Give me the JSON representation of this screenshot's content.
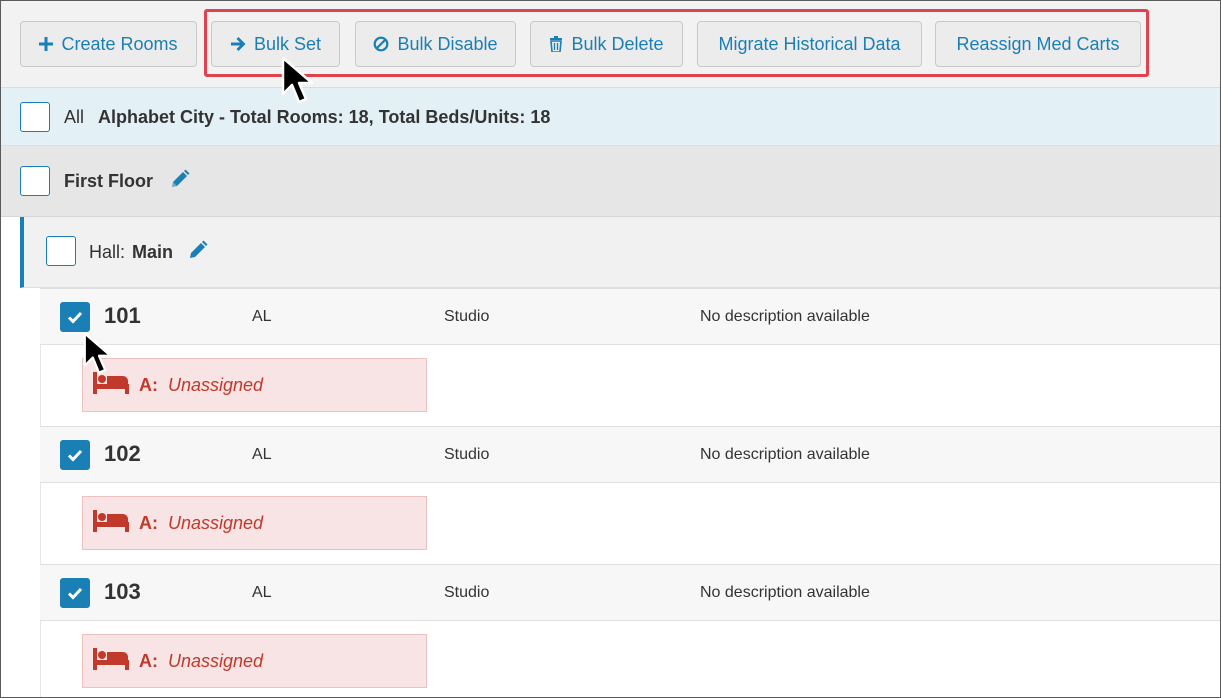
{
  "toolbar": {
    "create_rooms": "Create Rooms",
    "bulk_set": "Bulk Set",
    "bulk_disable": "Bulk Disable",
    "bulk_delete": "Bulk Delete",
    "migrate": "Migrate Historical Data",
    "reassign": "Reassign Med Carts"
  },
  "summary": {
    "all_label": "All",
    "text": "Alphabet City - Total Rooms: 18, Total Beds/Units: 18"
  },
  "floor": {
    "name": "First Floor"
  },
  "hall": {
    "prefix": "Hall:",
    "name": "Main"
  },
  "rooms": [
    {
      "number": "101",
      "type": "AL",
      "layout": "Studio",
      "description": "No description available",
      "bed_label": "A:",
      "bed_status": "Unassigned",
      "checked": true
    },
    {
      "number": "102",
      "type": "AL",
      "layout": "Studio",
      "description": "No description available",
      "bed_label": "A:",
      "bed_status": "Unassigned",
      "checked": true
    },
    {
      "number": "103",
      "type": "AL",
      "layout": "Studio",
      "description": "No description available",
      "bed_label": "A:",
      "bed_status": "Unassigned",
      "checked": true
    }
  ],
  "colors": {
    "accent": "#1a7fb5",
    "highlight": "#e0434d",
    "unassigned": "#c0392b"
  },
  "icons": [
    "plus-icon",
    "arrow-right-icon",
    "ban-icon",
    "trash-icon",
    "pencil-icon",
    "bed-icon",
    "check-icon",
    "mouse-cursor-icon"
  ]
}
